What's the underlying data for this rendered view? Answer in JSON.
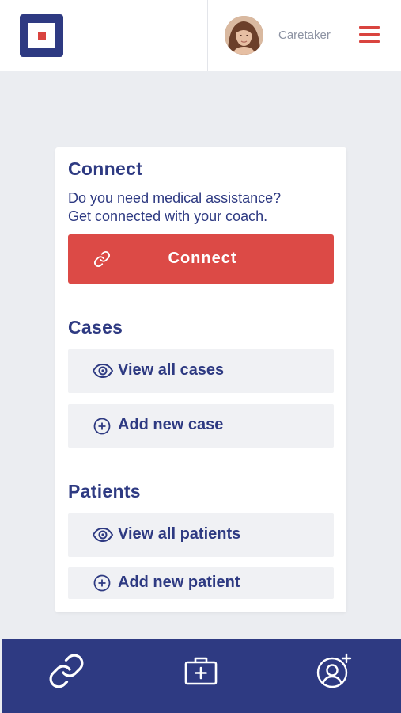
{
  "header": {
    "role": "Caretaker"
  },
  "connect": {
    "title": "Connect",
    "description_line1": "Do you need medical assistance?",
    "description_line2": "Get connected with your coach.",
    "button_label": "Connect"
  },
  "cases": {
    "title": "Cases",
    "view_all": "View all cases",
    "add_new": "Add new case"
  },
  "patients": {
    "title": "Patients",
    "view_all": "View all patients",
    "add_new": "Add new patient"
  },
  "colors": {
    "primary": "#2e3a82",
    "accent": "#dc4a46",
    "background": "#ebedf1"
  },
  "icons": [
    "logo-icon",
    "menu-icon",
    "link-icon",
    "eye-icon",
    "plus-circle-icon",
    "medical-kit-icon",
    "add-user-icon"
  ]
}
